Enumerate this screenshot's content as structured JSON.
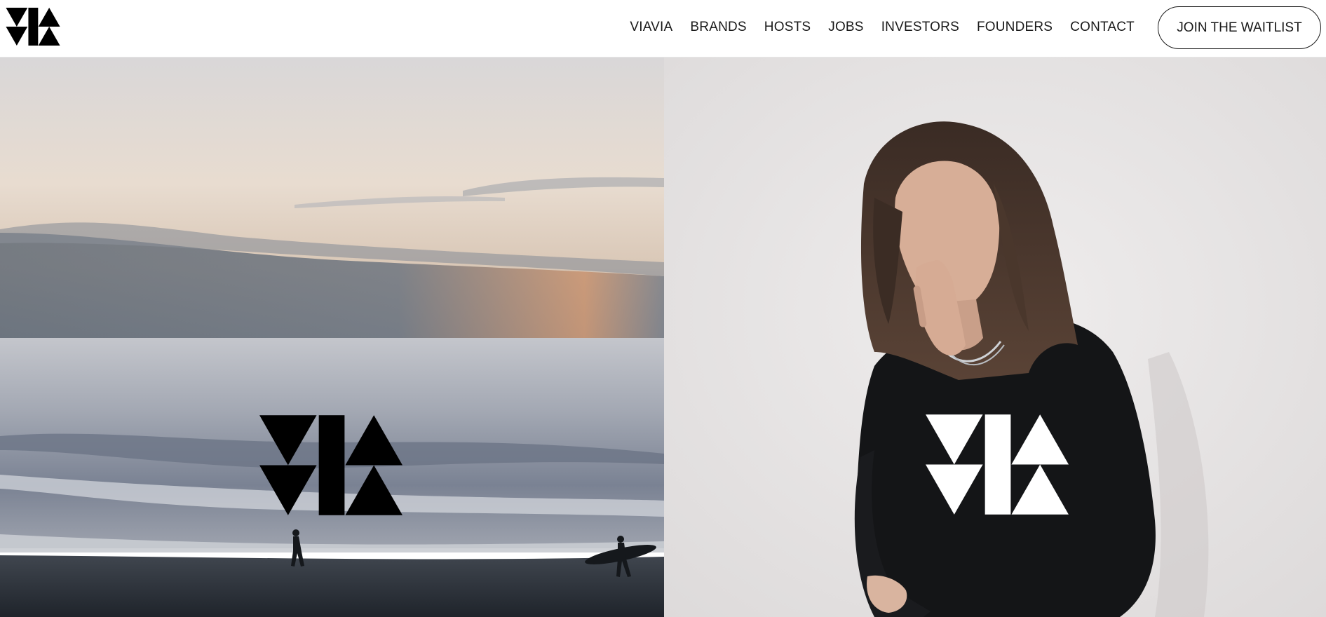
{
  "brand": {
    "logo_icon": "viavia-logo-icon"
  },
  "nav": {
    "items": [
      {
        "label": "VIAVIA"
      },
      {
        "label": "BRANDS"
      },
      {
        "label": "HOSTS"
      },
      {
        "label": "JOBS"
      },
      {
        "label": "INVESTORS"
      },
      {
        "label": "FOUNDERS"
      },
      {
        "label": "CONTACT"
      }
    ],
    "cta_label": "JOIN THE WAITLIST"
  },
  "hero": {
    "left_image": "beach-sunset-surfers-photo",
    "right_image": "woman-black-sweater-portrait-photo",
    "left_logo_color": "#000000",
    "right_logo_color": "#ffffff"
  },
  "colors": {
    "text": "#1a1a1a",
    "background": "#ffffff"
  }
}
